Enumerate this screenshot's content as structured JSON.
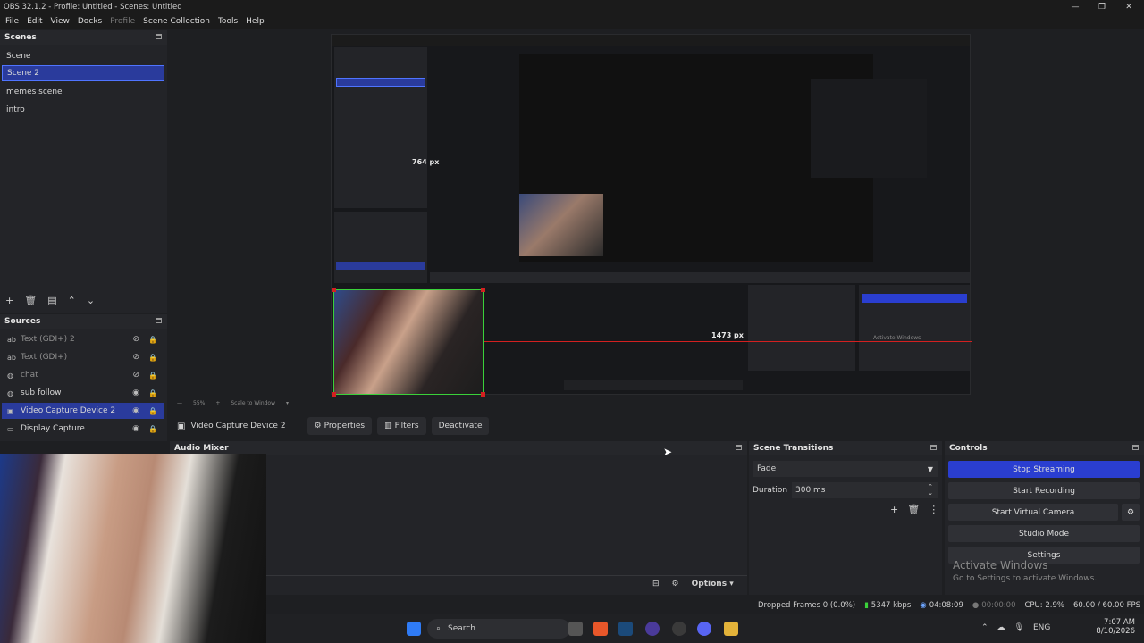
{
  "window": {
    "title": "OBS 32.1.2 - Profile: Untitled - Scenes: Untitled"
  },
  "menu": [
    "File",
    "Edit",
    "View",
    "Docks",
    "Profile",
    "Scene Collection",
    "Tools",
    "Help"
  ],
  "scenes": {
    "title": "Scenes",
    "items": [
      "Scene",
      "Scene 2",
      "memes scene",
      "intro"
    ],
    "selected": "Scene 2"
  },
  "sources": {
    "title": "Sources",
    "items": [
      {
        "label": "Text (GDI+) 2",
        "icon": "text-icon",
        "visible": false
      },
      {
        "label": "Text (GDI+)",
        "icon": "text-icon",
        "visible": false
      },
      {
        "label": "chat",
        "icon": "browser-icon",
        "visible": false
      },
      {
        "label": "sub follow",
        "icon": "browser-icon",
        "visible": true
      },
      {
        "label": "Video Capture Device 2",
        "icon": "camera-icon",
        "visible": true
      },
      {
        "label": "Display Capture",
        "icon": "monitor-icon",
        "visible": true
      }
    ],
    "selected": "Video Capture Device 2"
  },
  "preview": {
    "height_label": "764 px",
    "width_label": "1473 px",
    "inner_height_label": "764 px",
    "inner_width_label": "1473 px",
    "inner_zoom": "55%",
    "inner_scale": "Scale to Window"
  },
  "source_toolbar": {
    "name": "Video Capture Device 2",
    "properties": "Properties",
    "filters": "Filters",
    "deactivate": "Deactivate"
  },
  "audio_mixer": {
    "title": "Audio Mixer",
    "options": "Options"
  },
  "transitions": {
    "title": "Scene Transitions",
    "type": "Fade",
    "duration_label": "Duration",
    "duration": "300 ms"
  },
  "controls": {
    "title": "Controls",
    "stop_streaming": "Stop Streaming",
    "start_recording": "Start Recording",
    "start_virtual_camera": "Start Virtual Camera",
    "studio_mode": "Studio Mode",
    "settings": "Settings"
  },
  "watermark": {
    "title": "Activate Windows",
    "subtitle": "Go to Settings to activate Windows."
  },
  "status": {
    "dropped": "Dropped Frames 0 (0.0%)",
    "bitrate": "5347 kbps",
    "stream_time": "04:08:09",
    "rec_time": "00:00:00",
    "cpu": "CPU: 2.9%",
    "fps": "60.00 / 60.00 FPS"
  },
  "taskbar": {
    "search": "Search",
    "lang": "ENG",
    "time": "7:07 AM",
    "date": "8/10/2026"
  },
  "colors": {
    "accent": "#2a3ed0",
    "selection": "#2a3b9c",
    "guide": "#d32020",
    "bounds": "#3ad13a"
  }
}
